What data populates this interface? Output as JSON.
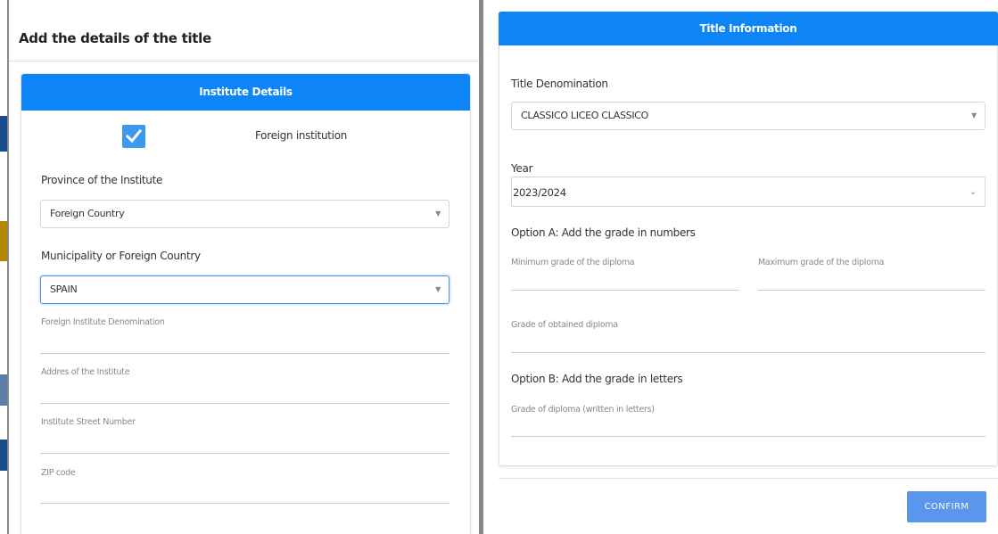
{
  "left": {
    "title": "Add the details of the title",
    "institute_header": "Institute Details",
    "foreign_institution_label": "Foreign institution",
    "foreign_institution_checked": true,
    "province_label": "Province of the Institute",
    "province_value": "Foreign Country",
    "municipality_label": "Municipality or Foreign Country",
    "municipality_value": "SPAIN",
    "foreign_denomination_label": "Foreign Institute Denomination",
    "address_label": "Addres of the Institute",
    "street_number_label": "Institute Street Number",
    "zip_label": "ZIP code"
  },
  "right": {
    "header": "Title Information",
    "denomination_label": "Title Denomination",
    "denomination_value": "CLASSICO LICEO CLASSICO",
    "year_label": "Year",
    "year_value": "2023/2024",
    "option_a_label": "Option A: Add the grade in numbers",
    "min_grade_label": "Minimum grade of the diploma",
    "max_grade_label": "Maximum grade of the diploma",
    "obtained_grade_label": "Grade of obtained diploma",
    "option_b_label": "Option B: Add the grade in letters",
    "letters_grade_label": "Grade of diploma (written in letters)",
    "confirm_label": "CONFIRM"
  },
  "colors": {
    "header_blue": "#0d85f6",
    "checkbox_blue": "#3b99ee",
    "confirm_blue": "#5a96ec"
  }
}
